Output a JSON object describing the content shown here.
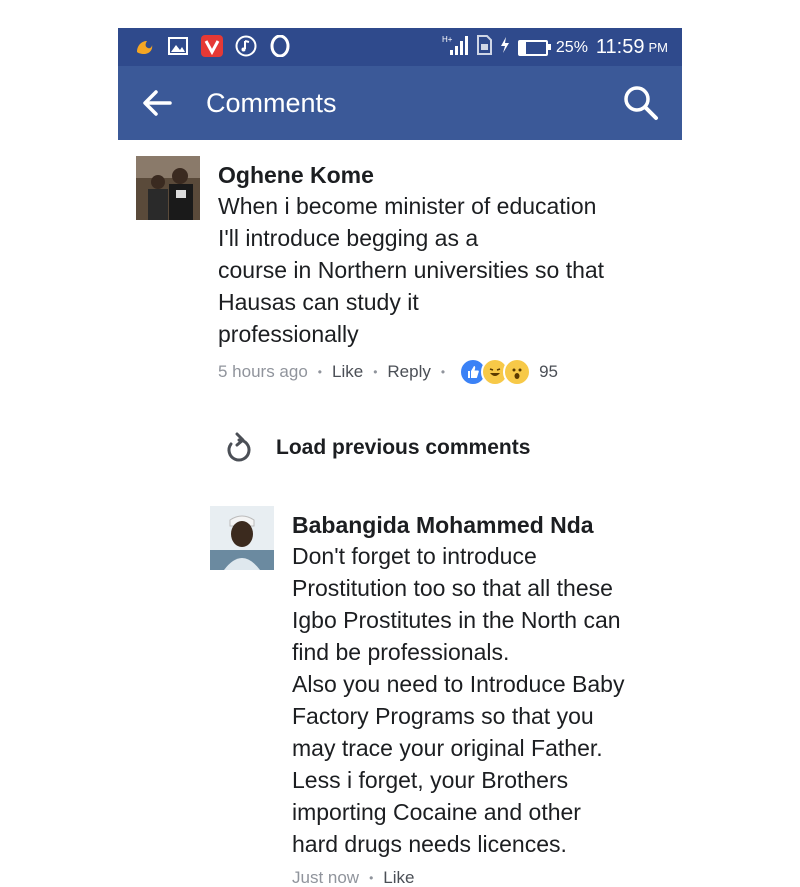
{
  "status_bar": {
    "icons": [
      "uc-browser-icon",
      "image-icon",
      "vivo-icon",
      "music-icon",
      "opera-icon"
    ],
    "network": "H+",
    "battery_percent_label": "25%",
    "battery_level": 0.25,
    "time": "11:59",
    "ampm": "PM"
  },
  "toolbar": {
    "title": "Comments"
  },
  "comments": [
    {
      "author": "Oghene Kome",
      "text": "When i become minister of education\nI'll introduce begging as a\ncourse in Northern universities so that\nHausas can study it\nprofessionally",
      "time": "5 hours ago",
      "like_label": "Like",
      "reply_label": "Reply",
      "reaction_count": "95"
    },
    {
      "author": "Babangida Mohammed Nda",
      "text": "Don't forget to introduce\nProstitution too so that all these\nIgbo Prostitutes in the North can\nfind be professionals.\nAlso you need to Introduce Baby\nFactory Programs so that you\nmay trace your original Father.\nLess i forget, your Brothers\nimporting Cocaine and other\nhard drugs needs licences.",
      "time": "Just now",
      "like_label": "Like"
    }
  ],
  "load_previous_label": "Load previous comments",
  "colors": {
    "status_bar": "#2f4a8c",
    "toolbar": "#3b5998",
    "meta_text": "#90949c"
  }
}
